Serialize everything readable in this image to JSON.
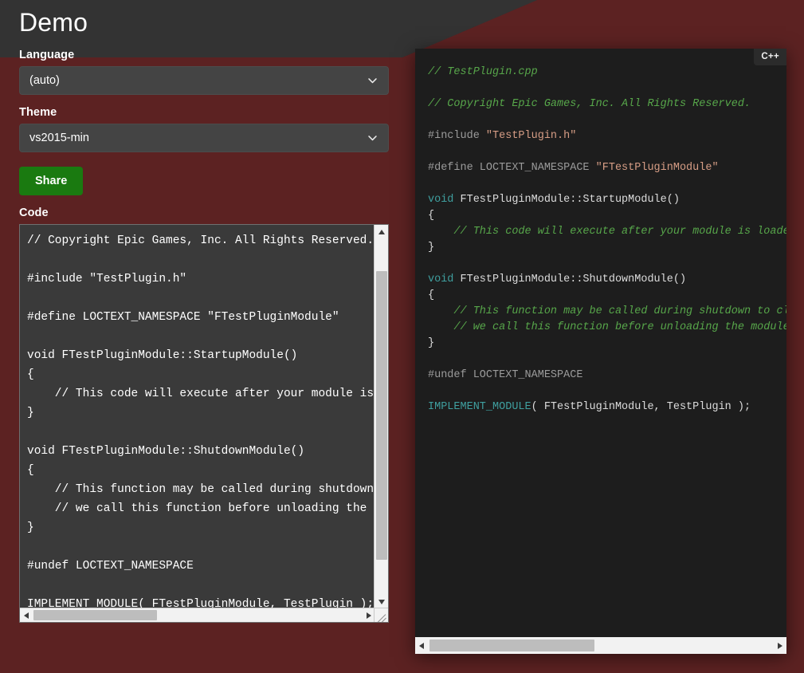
{
  "page": {
    "title": "Demo",
    "background_color": "#333333",
    "accent_red": "#5c2222"
  },
  "form": {
    "language_label": "Language",
    "language_value": "(auto)",
    "theme_label": "Theme",
    "theme_value": "vs2015-min",
    "share_label": "Share",
    "share_color": "#1a7a10",
    "code_label": "Code"
  },
  "editor": {
    "value": "// Copyright Epic Games, Inc. All Rights Reserved.\n\n#include \"TestPlugin.h\"\n\n#define LOCTEXT_NAMESPACE \"FTestPluginModule\"\n\nvoid FTestPluginModule::StartupModule()\n{\n    // This code will execute after your module is loaded into memory; the exact timing is specified in the .uplugin file per-module\n}\n\nvoid FTestPluginModule::ShutdownModule()\n{\n    // This function may be called during shutdown to clean up your module.  For modules that support dynamic reloading,\n    // we call this function before unloading the module.\n}\n\n#undef LOCTEXT_NAMESPACE\n\nIMPLEMENT_MODULE( FTestPluginModule, TestPlugin );"
  },
  "preview": {
    "language_badge": "C++",
    "background_color": "#1d1d1d",
    "colors": {
      "comment": "#57a64a",
      "preprocessor": "#9b9b9b",
      "string": "#d69d85",
      "keyword": "#3f9f9f",
      "plain": "#dcdcdc"
    },
    "lines": [
      [
        {
          "t": "// TestPlugin.cpp",
          "c": "comment"
        }
      ],
      [],
      [
        {
          "t": "// Copyright Epic Games, Inc. All Rights Reserved.",
          "c": "comment"
        }
      ],
      [],
      [
        {
          "t": "#include ",
          "c": "pre"
        },
        {
          "t": "\"TestPlugin.h\"",
          "c": "string"
        }
      ],
      [],
      [
        {
          "t": "#define LOCTEXT_NAMESPACE ",
          "c": "pre"
        },
        {
          "t": "\"FTestPluginModule\"",
          "c": "string"
        }
      ],
      [],
      [
        {
          "t": "void",
          "c": "key"
        },
        {
          "t": " FTestPluginModule::StartupModule()",
          "c": "plain"
        }
      ],
      [
        {
          "t": "{",
          "c": "plain"
        }
      ],
      [
        {
          "t": "    // This code will execute after your module is loaded into memory; the exact timing is specified in the .uplugin file per-module",
          "c": "comment"
        }
      ],
      [
        {
          "t": "}",
          "c": "plain"
        }
      ],
      [],
      [
        {
          "t": "void",
          "c": "key"
        },
        {
          "t": " FTestPluginModule::ShutdownModule()",
          "c": "plain"
        }
      ],
      [
        {
          "t": "{",
          "c": "plain"
        }
      ],
      [
        {
          "t": "    // This function may be called during shutdown to clean up your module.  For modules that support dynamic reloading,",
          "c": "comment"
        }
      ],
      [
        {
          "t": "    // we call this function before unloading the module.",
          "c": "comment"
        }
      ],
      [
        {
          "t": "}",
          "c": "plain"
        }
      ],
      [],
      [
        {
          "t": "#undef LOCTEXT_NAMESPACE",
          "c": "pre"
        }
      ],
      [],
      [
        {
          "t": "IMPLEMENT_MODULE",
          "c": "key"
        },
        {
          "t": "( FTestPluginModule, TestPlugin );",
          "c": "plain"
        }
      ]
    ]
  }
}
